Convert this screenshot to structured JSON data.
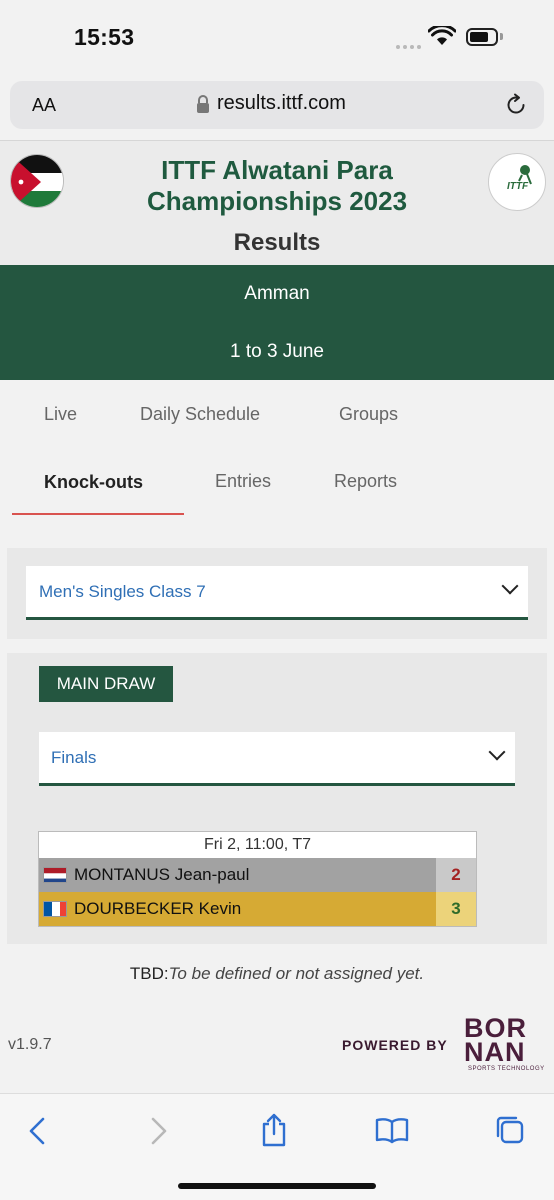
{
  "status_bar": {
    "time": "15:53"
  },
  "browser": {
    "aa_label": "AA",
    "url": "results.ittf.com"
  },
  "header": {
    "title": "ITTF Alwatani Para Championships 2023",
    "subtitle": "Results",
    "city": "Amman",
    "dates": "1 to 3 June",
    "ittf_logo_text": "ITTF"
  },
  "tabs": [
    "Live",
    "Daily Schedule",
    "Groups",
    "Knock-outs",
    "Entries",
    "Reports"
  ],
  "event_select": {
    "value": "Men's Singles Class 7"
  },
  "draw": {
    "button": "MAIN DRAW",
    "round_select": "Finals"
  },
  "match": {
    "info": "Fri 2, 11:00, T7",
    "players": [
      {
        "name": "MONTANUS Jean-paul",
        "score": "2"
      },
      {
        "name": "DOURBECKER Kevin",
        "score": "3"
      }
    ]
  },
  "legend": {
    "tbd_label": "TBD:",
    "tbd_text": "To be defined or not assigned yet."
  },
  "footer": {
    "version": "v1.9.7",
    "powered_by": "POWERED BY",
    "brand_top": "BOR",
    "brand_bottom": "NAN",
    "brand_sub": "SPORTS TECHNOLOGY"
  },
  "colors": {
    "primary_green": "#245640",
    "title_green": "#1f5a3f",
    "winner_gold": "#d6aa34",
    "tab_underline": "#d9534f",
    "link_blue": "#2f6fb5"
  },
  "icons": [
    "wifi-icon",
    "battery-icon",
    "lock-icon",
    "reload-icon",
    "back-icon",
    "forward-icon",
    "share-icon",
    "bookmarks-icon",
    "tabs-icon",
    "chevron-down-icon"
  ]
}
